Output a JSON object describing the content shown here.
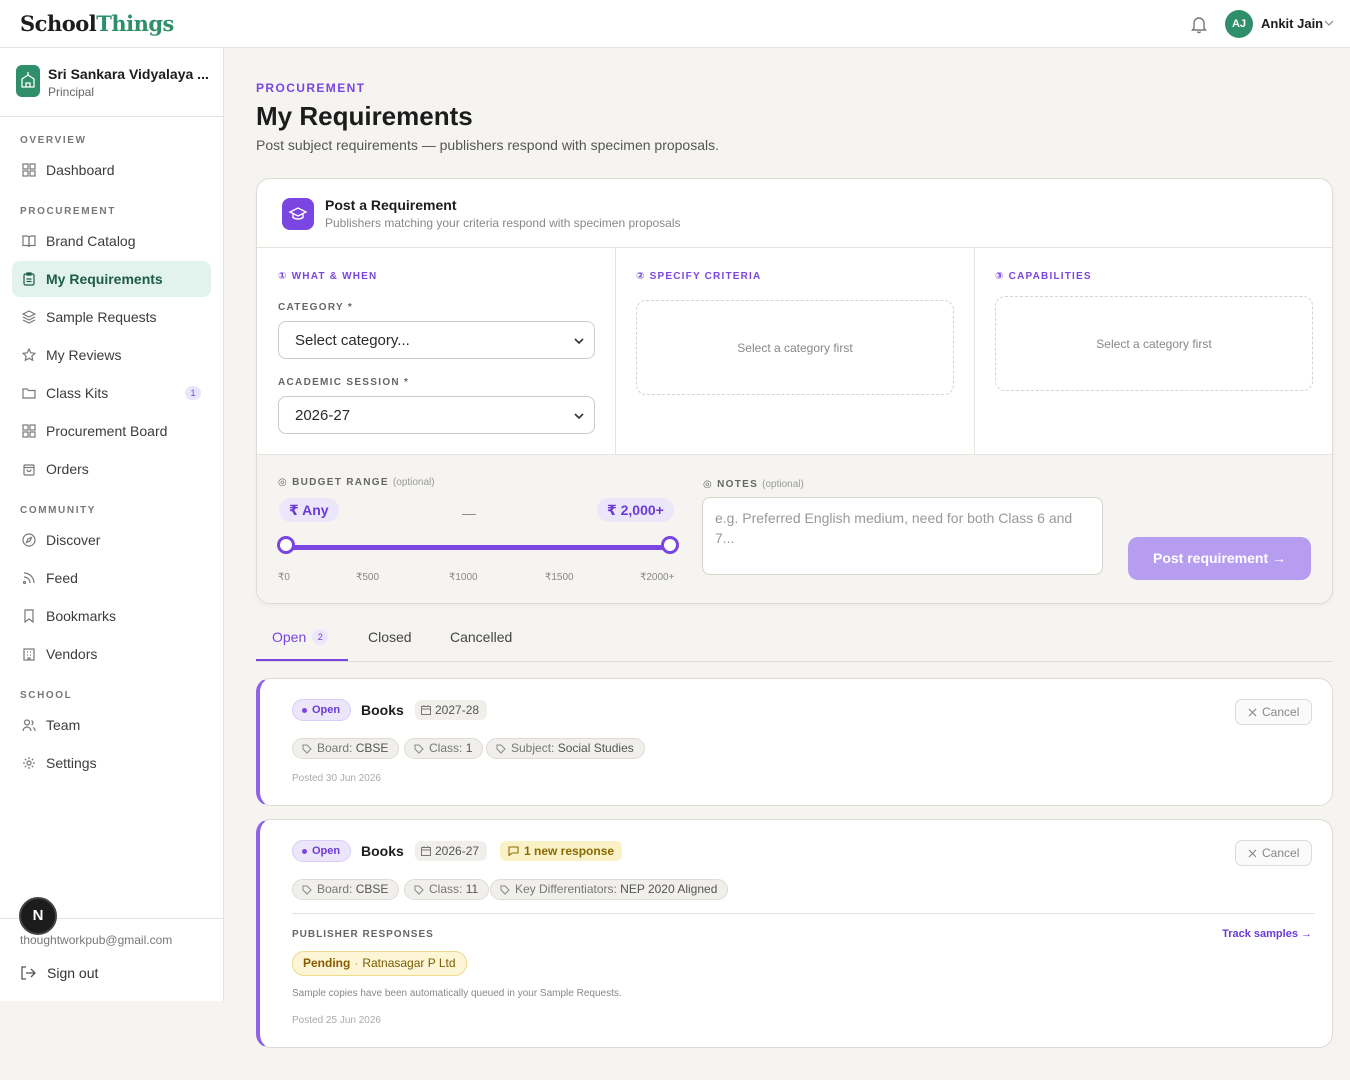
{
  "app": {
    "logo_part1": "School",
    "logo_part2": "Things"
  },
  "user": {
    "initials": "AJ",
    "name": "Ankit Jain"
  },
  "school": {
    "name": "Sri Sankara Vidyalaya ...",
    "role": "Principal"
  },
  "sidebar": {
    "sections": {
      "overview": "OVERVIEW",
      "procurement": "PROCUREMENT",
      "community": "COMMUNITY",
      "school": "SCHOOL"
    },
    "items": {
      "dashboard": "Dashboard",
      "brand_catalog": "Brand Catalog",
      "my_requirements": "My Requirements",
      "sample_requests": "Sample Requests",
      "my_reviews": "My Reviews",
      "class_kits": "Class Kits",
      "class_kits_badge": "1",
      "procurement_board": "Procurement Board",
      "orders": "Orders",
      "discover": "Discover",
      "feed": "Feed",
      "bookmarks": "Bookmarks",
      "vendors": "Vendors",
      "team": "Team",
      "settings": "Settings"
    },
    "email": "thoughtworkpub@gmail.com",
    "sign_out": "Sign out",
    "dev_badge": "N"
  },
  "header": {
    "eyebrow": "PROCUREMENT",
    "title": "My Requirements",
    "subtitle": "Post subject requirements — publishers respond with specimen proposals."
  },
  "post_form": {
    "title": "Post a Requirement",
    "subtitle": "Publishers matching your criteria respond with specimen proposals",
    "step1": "① WHAT & WHEN",
    "step2": "② SPECIFY CRITERIA",
    "step3": "③ CAPABILITIES",
    "category_label": "CATEGORY *",
    "category_value": "Select category...",
    "session_label": "ACADEMIC SESSION *",
    "session_value": "2026-27",
    "criteria_placeholder": "Select a category first",
    "capabilities_placeholder": "Select a category first",
    "budget_label": "◎ BUDGET RANGE",
    "optional": "(optional)",
    "budget_min": "₹ Any",
    "budget_dash": "—",
    "budget_max": "₹ 2,000+",
    "budget_range": {
      "min_fraction": 0,
      "max_fraction": 1
    },
    "ticks": [
      "₹0",
      "₹500",
      "₹1000",
      "₹1500",
      "₹2000+"
    ],
    "notes_label": "◎ NOTES",
    "notes_placeholder": "e.g. Preferred English medium, need for both Class 6 and 7...",
    "submit": "Post requirement →"
  },
  "tabs": {
    "open": "Open",
    "open_count": "2",
    "closed": "Closed",
    "cancelled": "Cancelled"
  },
  "requirements": [
    {
      "status": "Open",
      "type": "Books",
      "session": "2027-28",
      "tags": [
        {
          "key": "Board:",
          "value": "CBSE"
        },
        {
          "key": "Class:",
          "value": "1"
        },
        {
          "key": "Subject:",
          "value": "Social Studies"
        }
      ],
      "posted": "Posted 30 Jun 2026",
      "cancel": "Cancel"
    },
    {
      "status": "Open",
      "type": "Books",
      "session": "2026-27",
      "response_chip": "1 new response",
      "tags": [
        {
          "key": "Board:",
          "value": "CBSE"
        },
        {
          "key": "Class:",
          "value": "11"
        },
        {
          "key": "Key Differentiators:",
          "value": "NEP 2020 Aligned"
        }
      ],
      "publisher_label": "PUBLISHER RESPONSES",
      "track_link": "Track samples →",
      "response": {
        "status": "Pending",
        "sep": "·",
        "publisher": "Ratnasagar P Ltd"
      },
      "auto_note": "Sample copies have been automatically queued in your Sample Requests.",
      "posted": "Posted 25 Jun 2026",
      "cancel": "Cancel"
    }
  ],
  "colors": {
    "accent": "#7a45e0",
    "brand_green": "#2f8f6a",
    "active_nav_bg": "#e2f2ec"
  }
}
